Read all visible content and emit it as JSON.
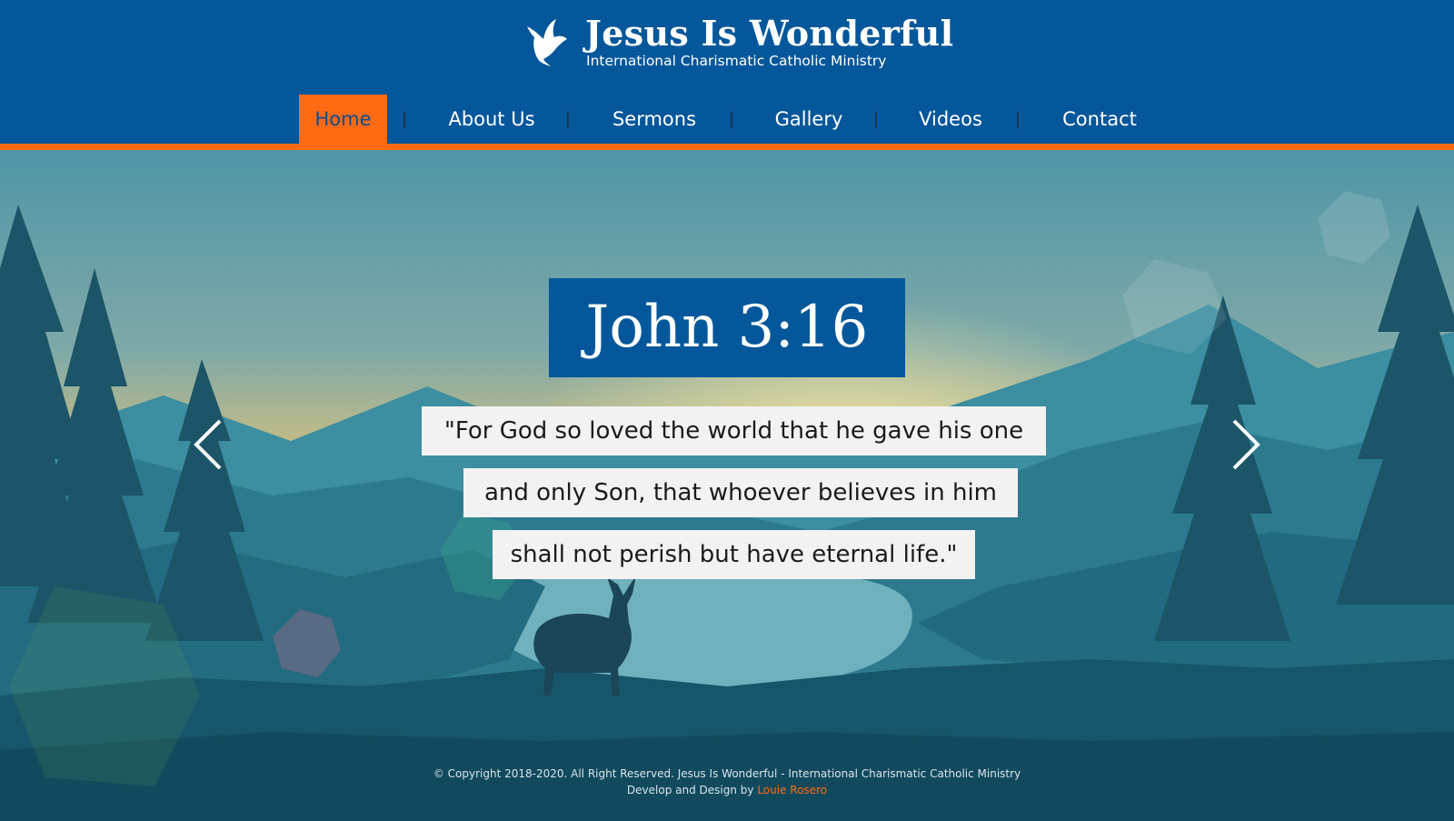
{
  "brand": {
    "title": "Jesus Is Wonderful",
    "subtitle": "International Charismatic Catholic Ministry",
    "logo_icon": "dove-icon"
  },
  "nav": {
    "items": [
      {
        "label": "Home",
        "active": true
      },
      {
        "label": "About Us",
        "active": false
      },
      {
        "label": "Sermons",
        "active": false
      },
      {
        "label": "Gallery",
        "active": false
      },
      {
        "label": "Videos",
        "active": false
      },
      {
        "label": "Contact",
        "active": false
      }
    ]
  },
  "slide": {
    "reference": "John 3:16",
    "lines": [
      "\"For God so loved the world that he gave his one",
      "and only Son, that whoever believes in him",
      "shall not perish but have eternal life.\""
    ],
    "prev_icon": "chevron-left-icon",
    "next_icon": "chevron-right-icon"
  },
  "footer": {
    "copyright": "© Copyright 2018-2020. All Right Reserved. Jesus Is Wonderful - International Charismatic Catholic Ministry",
    "credit_prefix": "Develop and Design by",
    "credit_author": "Louie Rosero"
  },
  "colors": {
    "header_blue": "#03579a",
    "accent_orange": "#ff6a13",
    "verse_box_bg": "#f2f2f2"
  }
}
